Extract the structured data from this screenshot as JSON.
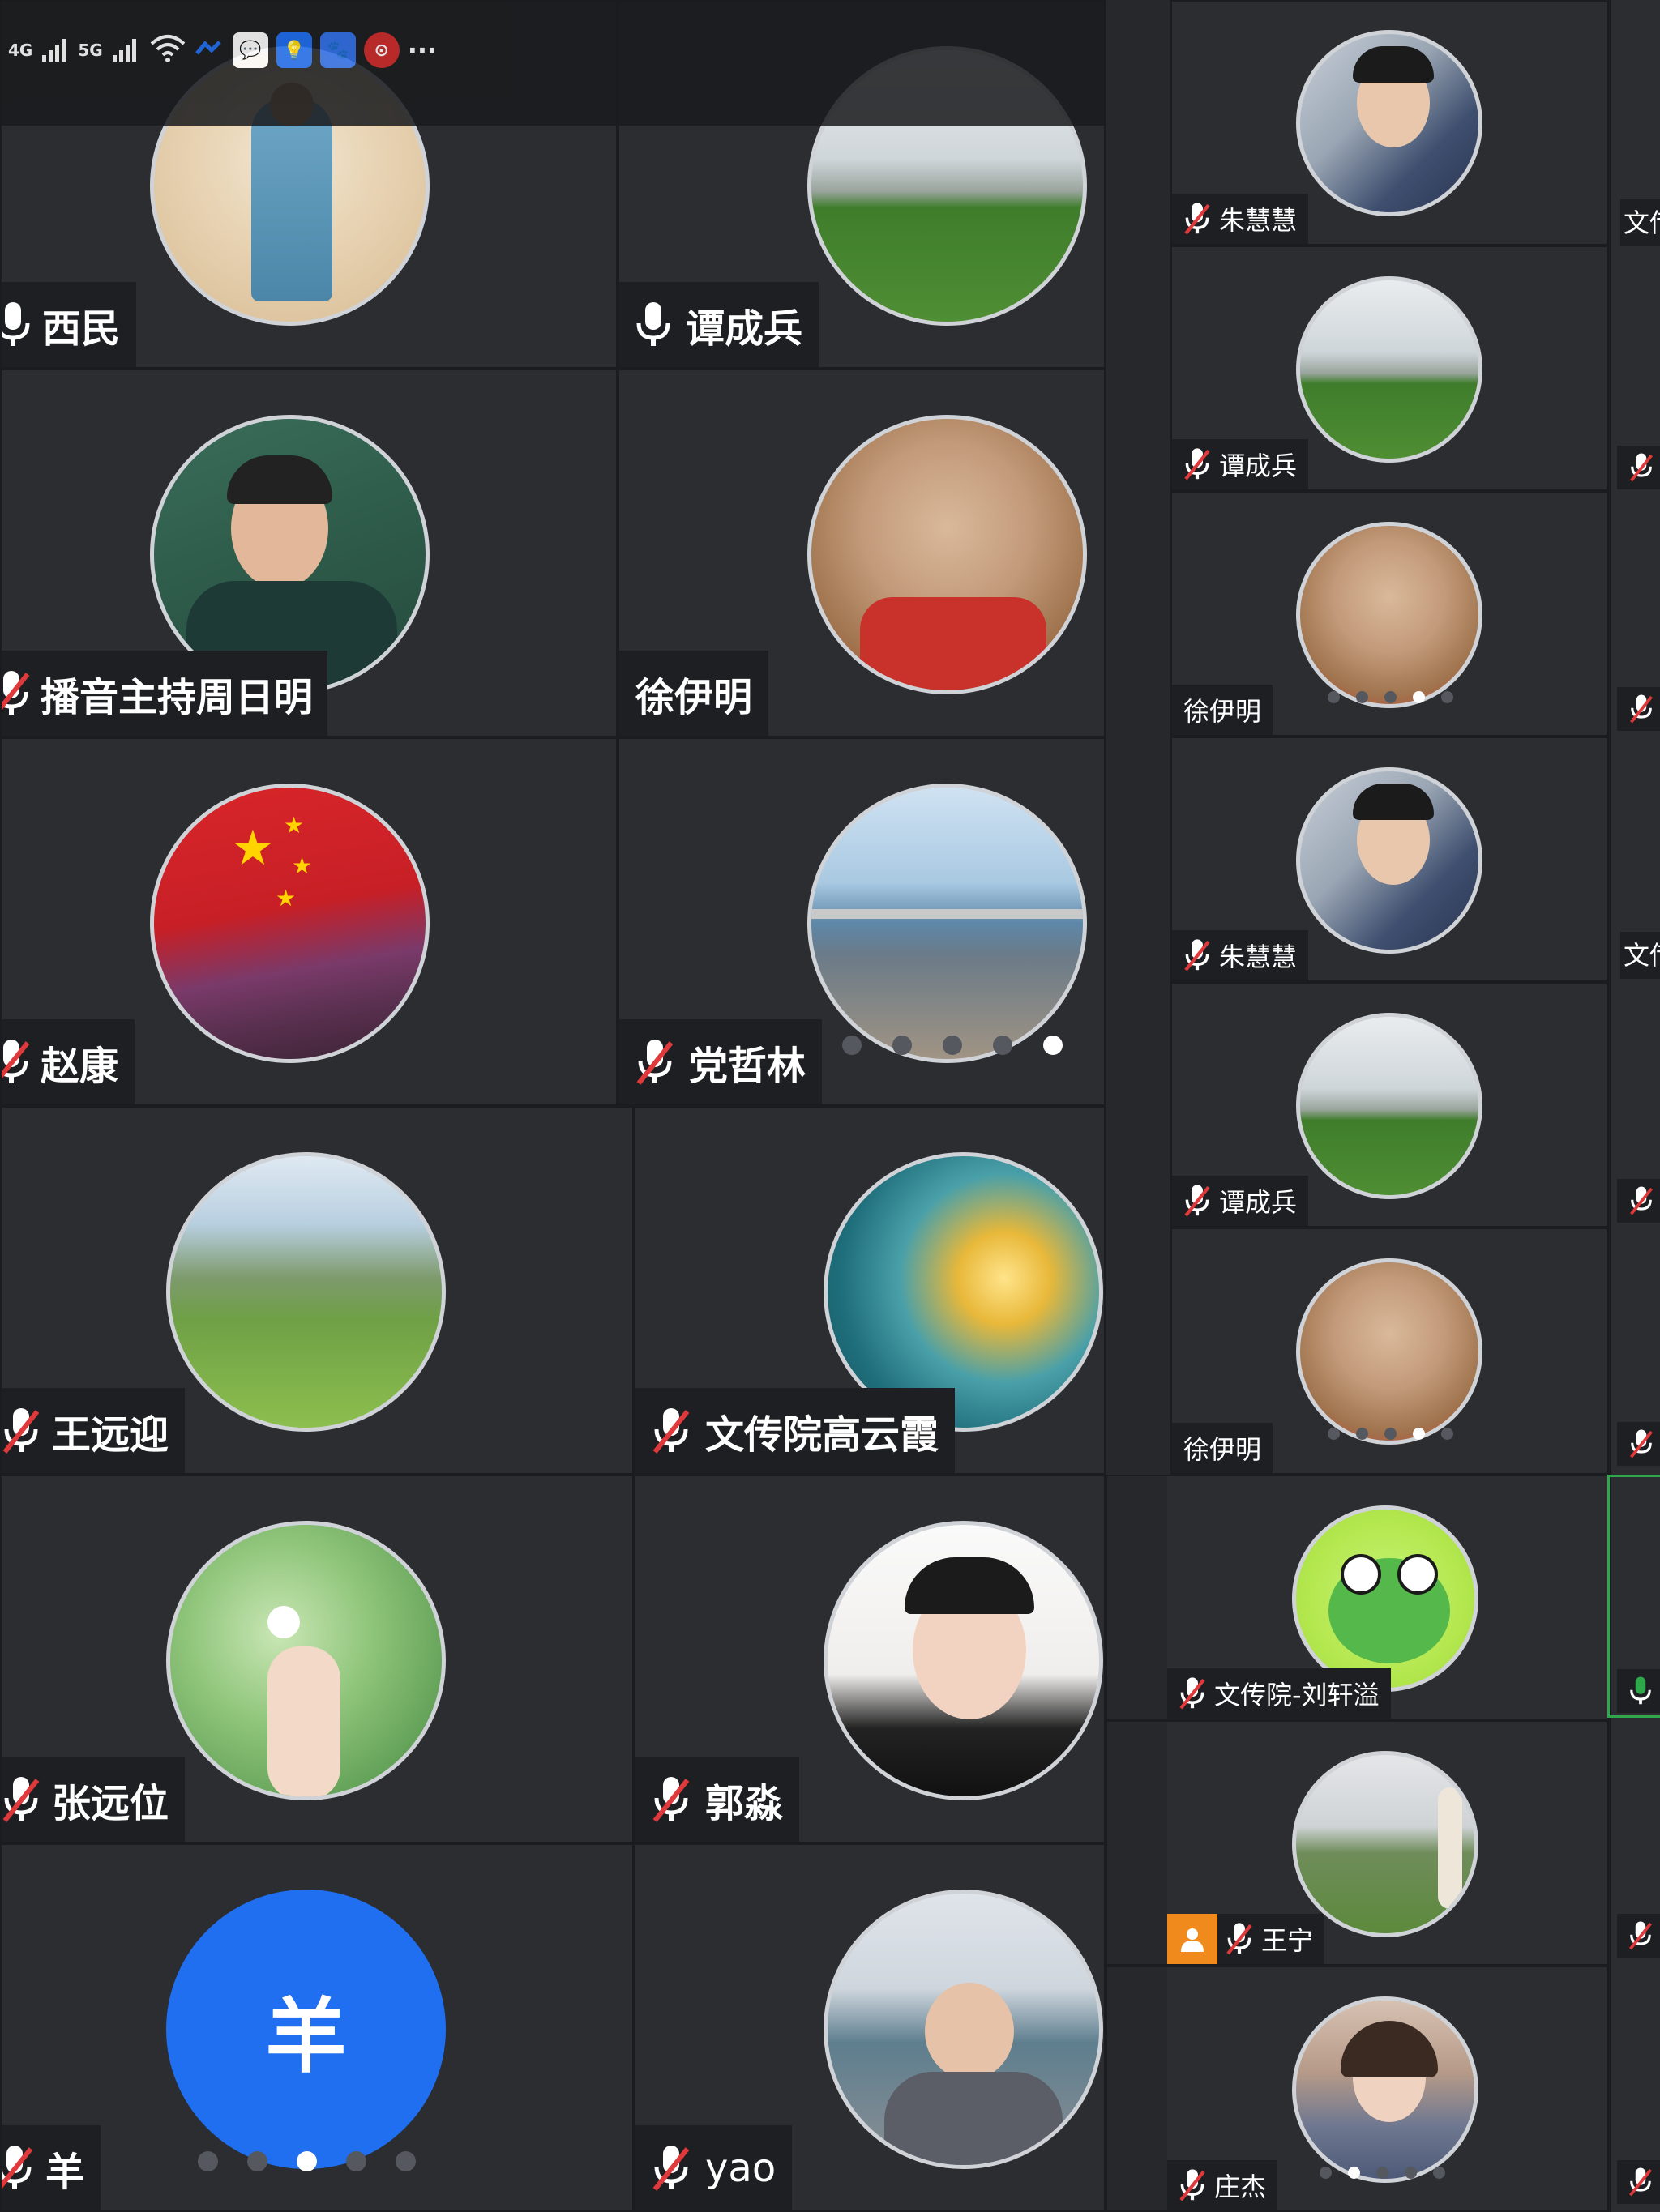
{
  "status_bar": {
    "signal_1": "4G",
    "signal_2": "5G",
    "more": "···",
    "app_icons": [
      "chat-bubble-icon",
      "bulb-icon",
      "paw-icon",
      "red-badge-icon"
    ]
  },
  "left_grid": {
    "tiles": [
      {
        "name": "西民",
        "mic": "on"
      },
      {
        "name": "谭成兵",
        "mic": "on"
      },
      {
        "name": "播音主持周日明",
        "mic": "muted"
      },
      {
        "name": "徐伊明",
        "mic": "none"
      },
      {
        "name": "赵康",
        "mic": "muted"
      },
      {
        "name": "党哲林",
        "mic": "muted"
      },
      {
        "name": "王远迎",
        "mic": "muted"
      },
      {
        "name": "文传院高云霞",
        "mic": "muted"
      },
      {
        "name": "张远位",
        "mic": "muted"
      },
      {
        "name": "郭淼",
        "mic": "muted"
      },
      {
        "name": "羊",
        "mic": "muted",
        "avatar_letter": "羊"
      },
      {
        "name": "yao",
        "mic": "muted"
      }
    ]
  },
  "right_grid": {
    "tiles": [
      {
        "name": "朱慧慧",
        "mic": "muted"
      },
      {
        "name": "谭成兵",
        "mic": "muted"
      },
      {
        "name": "徐伊明",
        "mic": "none"
      },
      {
        "name": "朱慧慧",
        "mic": "muted"
      },
      {
        "name": "谭成兵",
        "mic": "muted"
      },
      {
        "name": "徐伊明",
        "mic": "none"
      },
      {
        "name": "文传院-刘轩溢",
        "mic": "muted"
      },
      {
        "name": "王宁",
        "mic": "muted"
      },
      {
        "name": "庄杰",
        "mic": "muted"
      }
    ],
    "edge_labels": [
      "文传",
      "文传"
    ]
  },
  "colors": {
    "background": "#2b2d31",
    "nameplate": "#1e1f22",
    "mute_red": "#e0393b",
    "avatar_blue": "#1f6ff0",
    "active_speaker": "#2ea84a",
    "host_badge": "#f18a1c"
  }
}
